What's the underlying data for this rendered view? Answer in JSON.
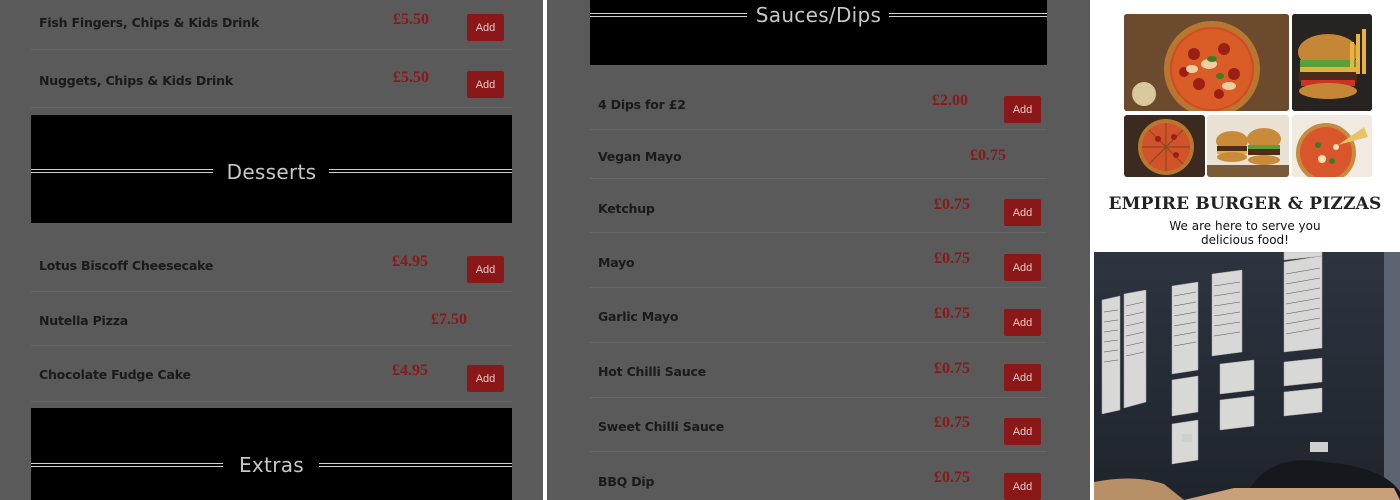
{
  "left_panel": {
    "kids_items": [
      {
        "name": "Fish Fingers, Chips & Kids Drink",
        "price": "£5.50",
        "add": "Add"
      },
      {
        "name": "Nuggets, Chips & Kids Drink",
        "price": "£5.50",
        "add": "Add"
      }
    ],
    "desserts_title": "Desserts",
    "dessert_items": [
      {
        "name": "Lotus Biscoff Cheesecake",
        "price": "£4.95",
        "add": "Add"
      },
      {
        "name": "Nutella Pizza",
        "price": "£7.50"
      },
      {
        "name": "Chocolate Fudge Cake",
        "price": "£4.95",
        "add": "Add"
      }
    ],
    "extras_title": "Extras"
  },
  "mid_panel": {
    "sauces_title": "Sauces/Dips",
    "sauce_items": [
      {
        "name": "4 Dips for £2",
        "price": "£2.00",
        "add": "Add"
      },
      {
        "name": "Vegan Mayo",
        "price": "£0.75"
      },
      {
        "name": "Ketchup",
        "price": "£0.75",
        "add": "Add"
      },
      {
        "name": "Mayo",
        "price": "£0.75",
        "add": "Add"
      },
      {
        "name": "Garlic Mayo",
        "price": "£0.75",
        "add": "Add"
      },
      {
        "name": "Hot Chilli Sauce",
        "price": "£0.75",
        "add": "Add"
      },
      {
        "name": "Sweet Chilli Sauce",
        "price": "£0.75",
        "add": "Add"
      },
      {
        "name": "BBQ Dip",
        "price": "£0.75",
        "add": "Add"
      }
    ]
  },
  "brand": {
    "name": "EMPIRE BURGER & PIZZAS",
    "tagline_line1": "We are here to serve you",
    "tagline_line2": "delicious food!"
  },
  "wall_menu_signs": [
    "Sides",
    "Extras",
    "Wraps",
    "Milkshakes",
    "Desserts",
    "Main Meals",
    "Kids Meals",
    "Sauces/Dips"
  ],
  "colors": {
    "accent": "#8a1818",
    "panel_bg": "#5a5a5a",
    "header_bg": "#000000"
  }
}
